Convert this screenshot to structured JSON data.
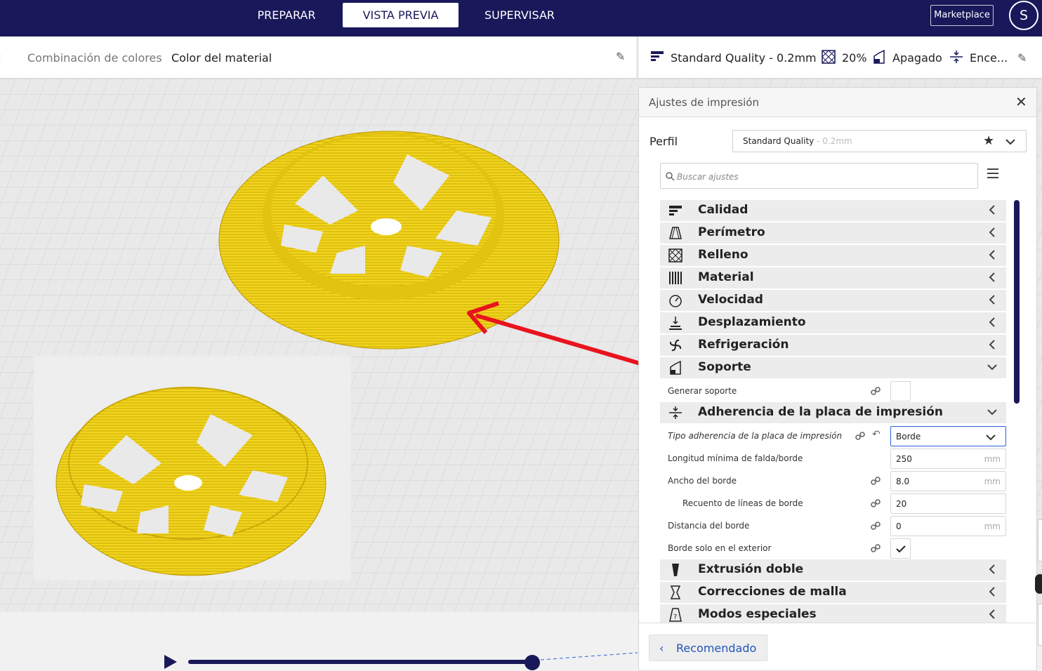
{
  "top_bar": {
    "tabs": [
      "PREPARAR",
      "VISTA PREVIA",
      "SUPERVISAR"
    ],
    "active_tab": "VISTA PREVIA",
    "marketplace": "Marketplace",
    "avatar_initial": "S"
  },
  "color_header": {
    "label": "Combinación de colores",
    "value": "Color del material"
  },
  "quality_header": {
    "profile": "Standard Quality - 0.2mm",
    "infill": "20%",
    "support": "Apagado",
    "adhesion": "Ence..."
  },
  "settings_panel": {
    "title": "Ajustes de impresión",
    "profile_label": "Perfil",
    "profile_name": "Standard Quality",
    "profile_layer": " - 0.2mm",
    "search_placeholder": "Buscar ajustes",
    "categories_top": [
      {
        "label": "Calidad",
        "icon": "quality-icon"
      },
      {
        "label": "Perímetro",
        "icon": "shell-icon"
      },
      {
        "label": "Relleno",
        "icon": "infill-icon"
      },
      {
        "label": "Material",
        "icon": "material-icon"
      },
      {
        "label": "Velocidad",
        "icon": "speed-icon"
      },
      {
        "label": "Desplazamiento",
        "icon": "travel-icon"
      },
      {
        "label": "Refrigeración",
        "icon": "cooling-icon"
      },
      {
        "label": "Soporte",
        "icon": "support-icon"
      }
    ],
    "support_settings": {
      "generate_support": "Generar soporte"
    },
    "adhesion_category": "Adherencia de la placa de impresión",
    "adhesion_settings": {
      "type_label": "Tipo adherencia de la placa de impresión",
      "type_value": "Borde",
      "min_length_label": "Longitud mínima de falda/borde",
      "min_length_value": "250",
      "width_label": "Ancho del borde",
      "width_value": "8.0",
      "line_count_label": "Recuento de líneas de borde",
      "line_count_value": "20",
      "distance_label": "Distancia del borde",
      "distance_value": "0",
      "outside_only_label": "Borde solo en el exterior",
      "unit": "mm"
    },
    "categories_bottom": [
      {
        "label": "Extrusión doble",
        "icon": "dual-extrusion-icon"
      },
      {
        "label": "Correcciones de malla",
        "icon": "mesh-fixes-icon"
      },
      {
        "label": "Modos especiales",
        "icon": "special-modes-icon"
      }
    ],
    "recommended_button": "Recomendado"
  },
  "colors": {
    "brand": "#19185a",
    "model": "#f2d51c",
    "arrow": "#e8141e"
  }
}
